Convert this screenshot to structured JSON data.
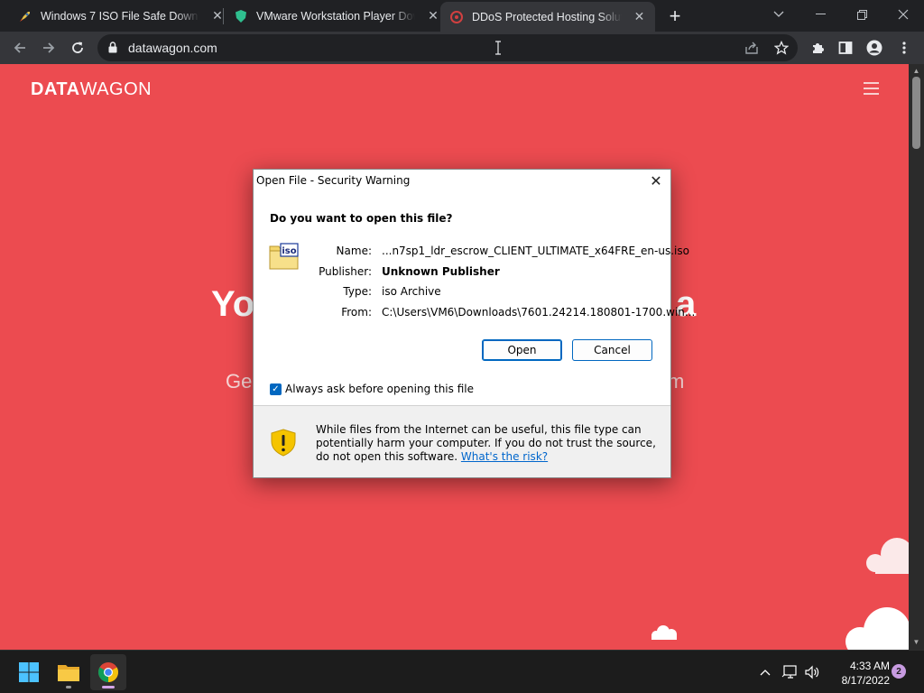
{
  "browser": {
    "tabs": [
      {
        "title": "Windows 7 ISO File Safe Download",
        "icon": "rocket-favicon"
      },
      {
        "title": "VMware Workstation Player Down",
        "icon": "shield-favicon"
      },
      {
        "title": "DDoS Protected Hosting Solution",
        "icon": "datawagon-favicon",
        "active": true
      }
    ],
    "url": "datawagon.com"
  },
  "page": {
    "logo_bold": "DATA",
    "logo_light": "WAGON",
    "hero_left": "Yo",
    "hero_right": "a",
    "sub_left": "Ge",
    "sub_right": "m",
    "background_color": "#ec4b50"
  },
  "dialog": {
    "title": "Open File - Security Warning",
    "question": "Do you want to open this file?",
    "fields": [
      {
        "label": "Name:",
        "value": "...n7sp1_ldr_escrow_CLIENT_ULTIMATE_x64FRE_en-us.iso"
      },
      {
        "label": "Publisher:",
        "value": "Unknown Publisher"
      },
      {
        "label": "Type:",
        "value": "iso Archive"
      },
      {
        "label": "From:",
        "value": "C:\\Users\\VM6\\Downloads\\7601.24214.180801-1700.win..."
      }
    ],
    "file_icon_label": "iso",
    "open_label": "Open",
    "cancel_label": "Cancel",
    "checkbox_label": "Always ask before opening this file",
    "checkbox_checked": true,
    "warning_text": "While files from the Internet can be useful, this file type can potentially harm your computer. If you do not trust the source, do not open this software.",
    "warning_link": "What's the risk?"
  },
  "taskbar": {
    "time": "4:33 AM",
    "date": "8/17/2022",
    "notification_count": "2"
  }
}
